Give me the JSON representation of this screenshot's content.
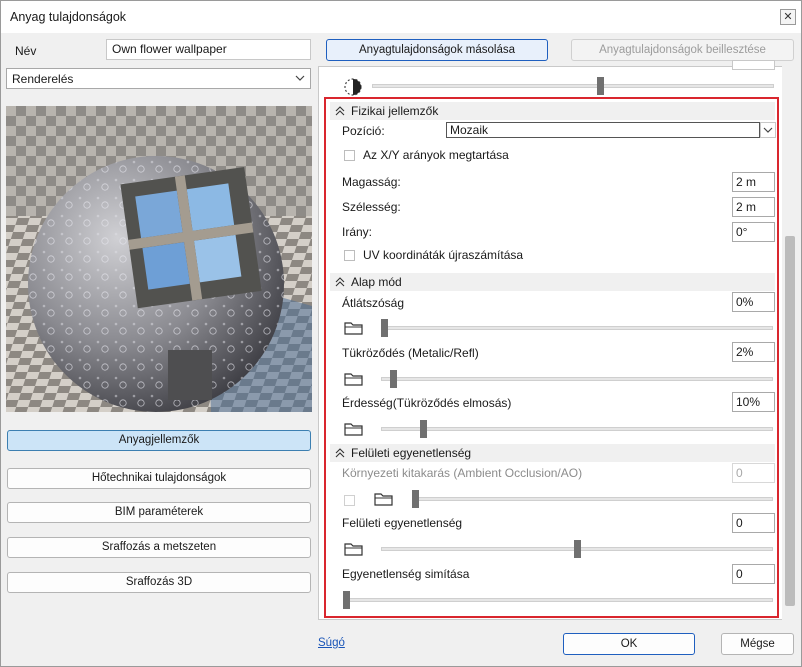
{
  "window": {
    "title": "Anyag tulajdonságok",
    "close_glyph": "✕"
  },
  "left": {
    "name_label": "Név",
    "name_value": "Own flower wallpaper",
    "mode_select": "Renderelés",
    "buttons": [
      {
        "label": "Anyagjellemzők",
        "active": true
      },
      {
        "label": "Hőtechnikai tulajdonságok",
        "active": false
      },
      {
        "label": "BIM paraméterek",
        "active": false
      },
      {
        "label": "Sraffozás a metszeten",
        "active": false
      },
      {
        "label": "Sraffozás 3D",
        "active": false
      }
    ]
  },
  "toolbar": {
    "copy_label": "Anyagtulajdonságok másolása",
    "paste_label": "Anyagtulajdonságok beillesztése"
  },
  "physical": {
    "title": "Fizikai jellemzők",
    "position_label": "Pozíció:",
    "position_value": "Mozaik",
    "keep_ratio_label": "Az X/Y arányok megtartása",
    "height_label": "Magasság:",
    "height_value": "2 m",
    "width_label": "Szélesség:",
    "width_value": "2 m",
    "direction_label": "Irány:",
    "direction_value": "0°",
    "uv_label": "UV koordináták újraszámítása"
  },
  "base": {
    "title": "Alap mód",
    "transparency_label": "Átlátszóság",
    "transparency_value": "0%",
    "transparency_level": 0.0,
    "reflection_label": "Tükröződés (Metalic/Refl)",
    "reflection_value": "2%",
    "reflection_level": 0.02,
    "roughness_label": "Érdesség(Tükröződés elmosás)",
    "roughness_value": "10%",
    "roughness_level": 0.1
  },
  "surface": {
    "title": "Felületi egyenetlenség",
    "ao_label": "Környezeti kitakarás (Ambient Occlusion/AO)",
    "ao_value": "0",
    "bump_label": "Felületi egyenetlenség",
    "bump_value": "0",
    "smooth_label": "Egyenetlenség simítása",
    "smooth_value": "0"
  },
  "footer": {
    "help": "Súgó",
    "ok": "OK",
    "cancel": "Mégse"
  }
}
